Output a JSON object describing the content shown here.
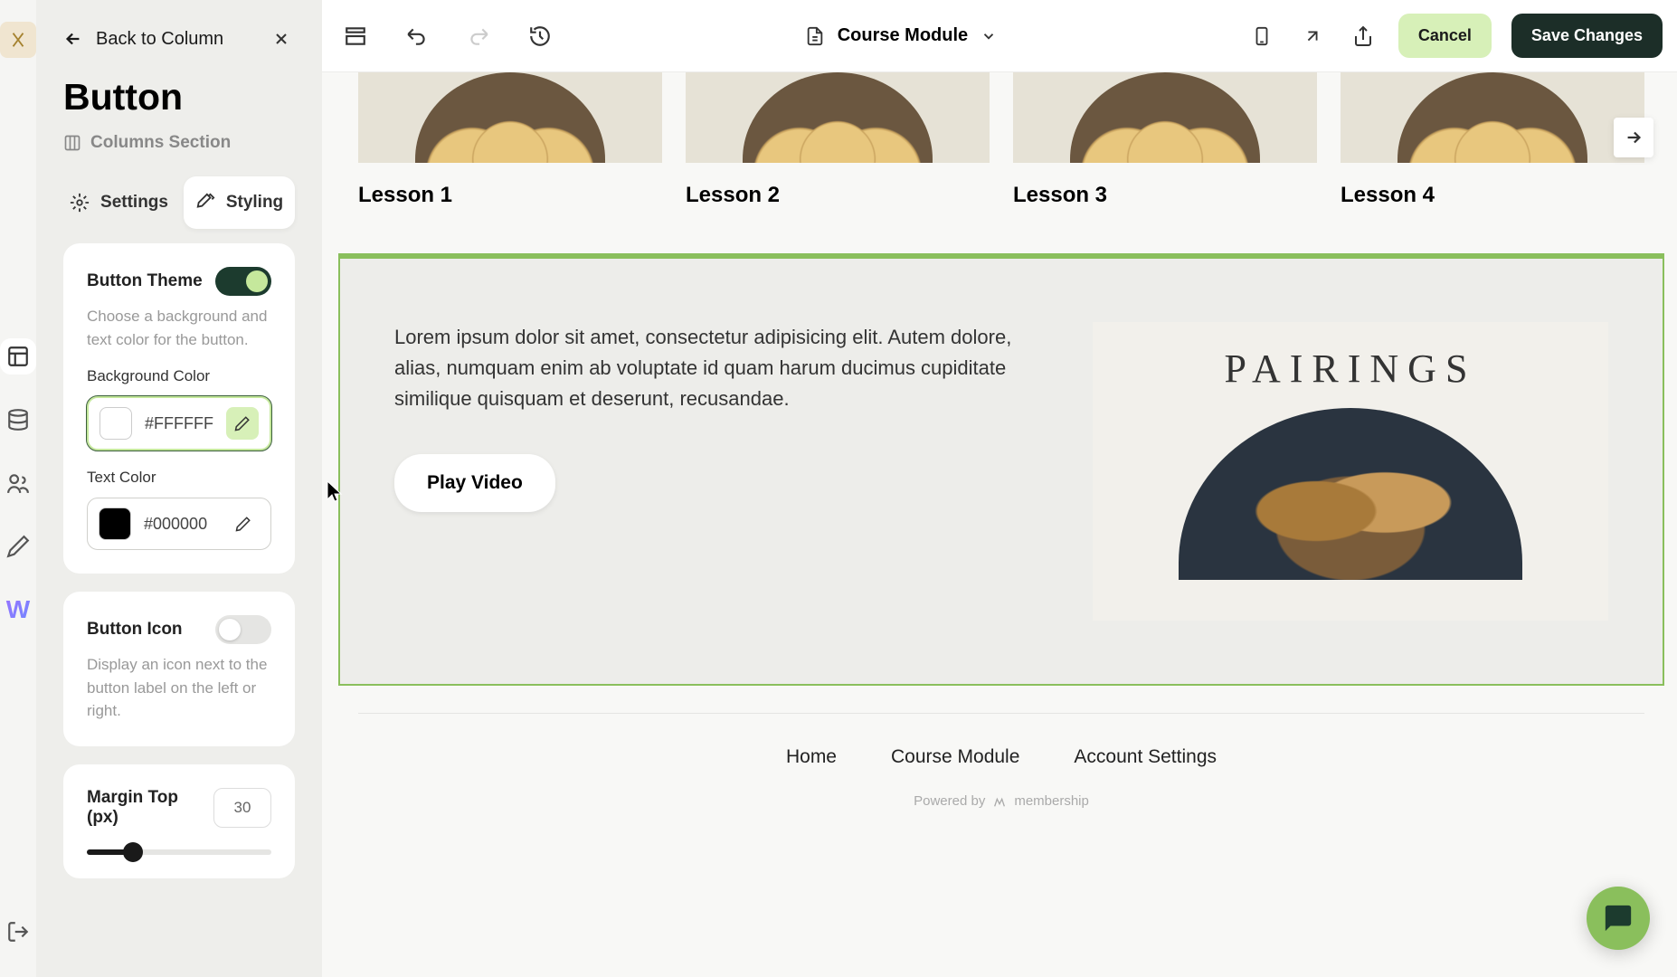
{
  "header": {
    "back_label": "Back to Column",
    "title": "Button",
    "breadcrumb": "Columns Section"
  },
  "tabs": {
    "settings": "Settings",
    "styling": "Styling",
    "active": "styling"
  },
  "button_theme": {
    "title": "Button Theme",
    "desc": "Choose a background and text color for the button.",
    "bg_label": "Background Color",
    "bg_value": "#FFFFFF",
    "text_label": "Text Color",
    "text_value": "#000000"
  },
  "button_icon": {
    "title": "Button Icon",
    "desc": "Display an icon next to the button label on the left or right."
  },
  "margin": {
    "title": "Margin Top (px)",
    "value": "30"
  },
  "topbar": {
    "doc_name": "Course Module",
    "cancel": "Cancel",
    "save": "Save Changes"
  },
  "lessons": [
    {
      "title": "Lesson 1"
    },
    {
      "title": "Lesson 2"
    },
    {
      "title": "Lesson 3"
    },
    {
      "title": "Lesson 4"
    }
  ],
  "section": {
    "body": "Lorem ipsum dolor sit amet, consectetur adipisicing elit. Autem dolore, alias, numquam enim ab voluptate id quam harum ducimus cupiditate similique quisquam et deserunt, recusandae.",
    "cta": "Play Video",
    "media_title": "PAIRINGS"
  },
  "footer": {
    "home": "Home",
    "module": "Course Module",
    "account": "Account Settings",
    "powered": "Powered by",
    "brand": "membership"
  }
}
